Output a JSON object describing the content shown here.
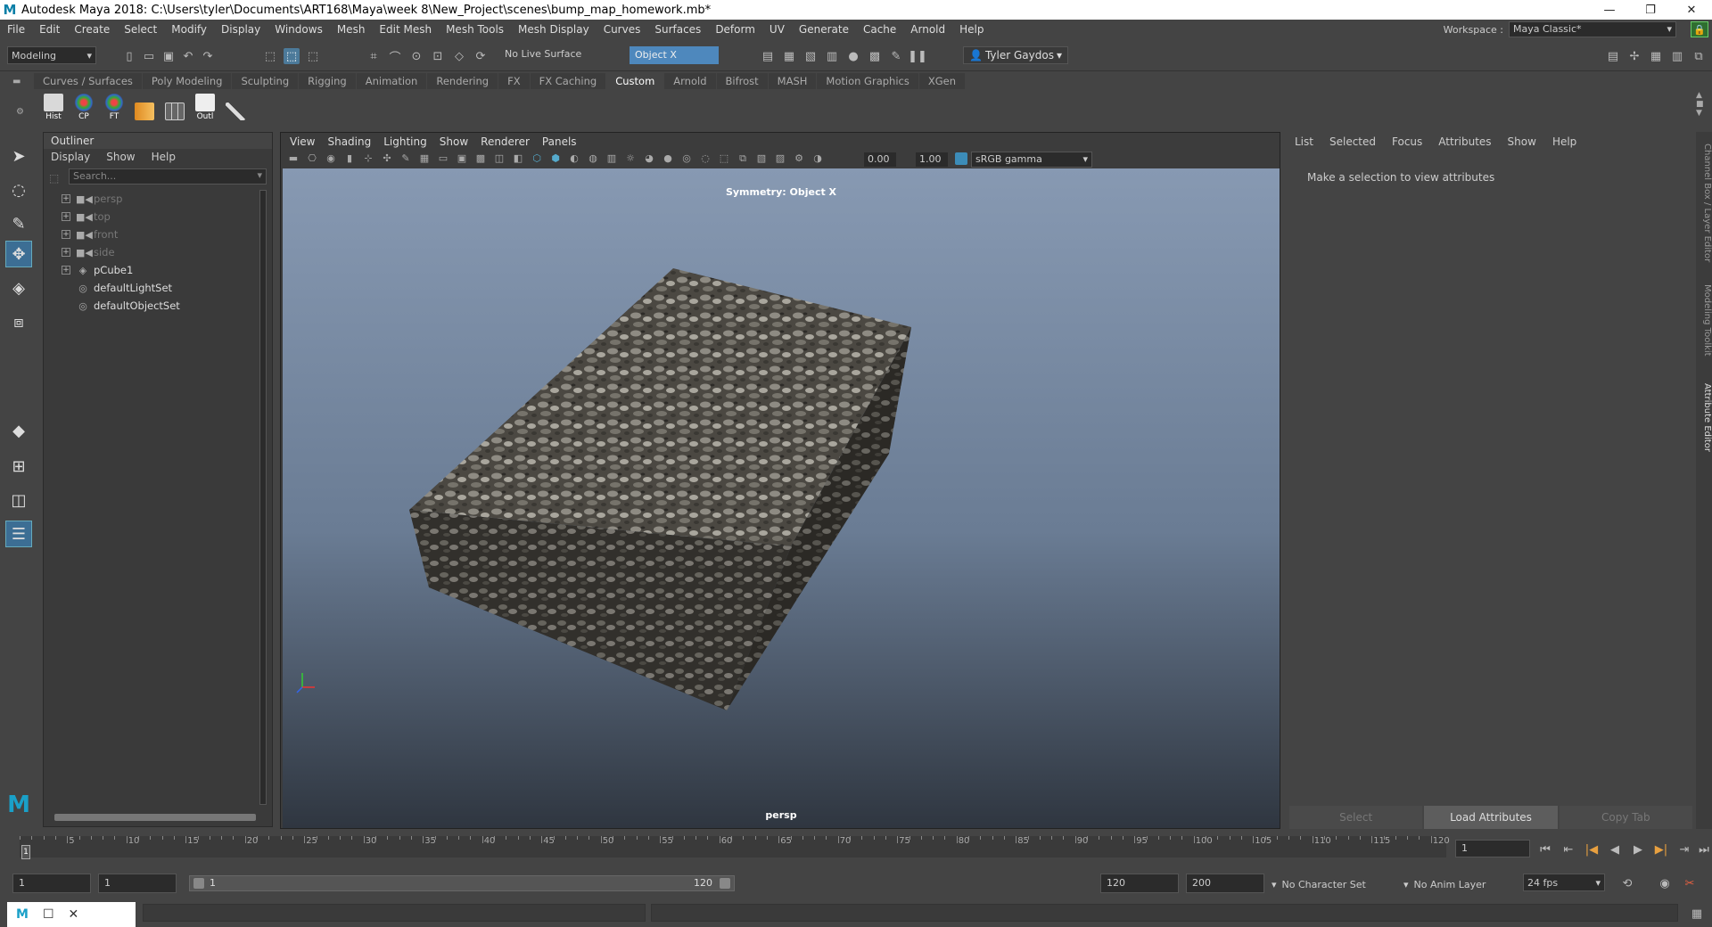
{
  "title_bar": {
    "logo": "M",
    "title": "Autodesk Maya 2018: C:\\Users\\tyler\\Documents\\ART168\\Maya\\week 8\\New_Project\\scenes\\bump_map_homework.mb*",
    "minimize": "—",
    "restore": "❐",
    "close": "✕"
  },
  "menu_bar": {
    "items": [
      "File",
      "Edit",
      "Create",
      "Select",
      "Modify",
      "Display",
      "Windows",
      "Mesh",
      "Edit Mesh",
      "Mesh Tools",
      "Mesh Display",
      "Curves",
      "Surfaces",
      "Deform",
      "UV",
      "Generate",
      "Cache",
      "Arnold",
      "Help"
    ],
    "workspace_label": "Workspace :",
    "workspace_value": "Maya Classic*"
  },
  "status_line": {
    "menu_set": "Modeling",
    "live_surface": "No Live Surface",
    "symmetry": "Object X",
    "user": "Tyler Gaydos"
  },
  "shelf": {
    "tabs": [
      "Curves / Surfaces",
      "Poly Modeling",
      "Sculpting",
      "Rigging",
      "Animation",
      "Rendering",
      "FX",
      "FX Caching",
      "Custom",
      "Arnold",
      "Bifrost",
      "MASH",
      "Motion Graphics",
      "XGen"
    ],
    "active_tab": "Custom",
    "buttons": [
      "Hist",
      "CP",
      "FT",
      "",
      "",
      "Outl",
      ""
    ]
  },
  "outliner": {
    "title": "Outliner",
    "menu": [
      "Display",
      "Show",
      "Help"
    ],
    "search_placeholder": "Search...",
    "nodes": [
      {
        "label": "persp",
        "icon": "camera-icon",
        "dim": true,
        "expandable": true
      },
      {
        "label": "top",
        "icon": "camera-icon",
        "dim": true,
        "expandable": true
      },
      {
        "label": "front",
        "icon": "camera-icon",
        "dim": true,
        "expandable": true
      },
      {
        "label": "side",
        "icon": "camera-icon",
        "dim": true,
        "expandable": true
      },
      {
        "label": "pCube1",
        "icon": "transform-icon",
        "dim": false,
        "expandable": true
      },
      {
        "label": "defaultLightSet",
        "icon": "set-icon",
        "dim": false,
        "expandable": false
      },
      {
        "label": "defaultObjectSet",
        "icon": "set-icon",
        "dim": false,
        "expandable": false
      }
    ]
  },
  "viewport": {
    "menu": [
      "View",
      "Shading",
      "Lighting",
      "Show",
      "Renderer",
      "Panels"
    ],
    "exposure": "0.00",
    "gamma": "1.00",
    "color_space": "sRGB gamma",
    "symmetry_label": "Symmetry: Object X",
    "camera_label": "persp"
  },
  "attribute_editor": {
    "menu": [
      "List",
      "Selected",
      "Focus",
      "Attributes",
      "Show",
      "Help"
    ],
    "message": "Make a selection to view attributes",
    "buttons": [
      "Select",
      "Load Attributes",
      "Copy Tab"
    ],
    "side_tabs": [
      "Channel Box / Layer Editor",
      "Modeling Toolkit",
      "Attribute Editor"
    ]
  },
  "time_slider": {
    "ticks": [
      "5",
      "10",
      "15",
      "20",
      "25",
      "30",
      "35",
      "40",
      "45",
      "50",
      "55",
      "60",
      "65",
      "70",
      "75",
      "80",
      "85",
      "90",
      "95",
      "100",
      "105",
      "110",
      "115",
      "120"
    ],
    "start_label": "1",
    "current_frame": "1",
    "current_field": "1"
  },
  "range_slider": {
    "start": "1",
    "playback_start": "1",
    "range_start": "1",
    "range_end": "120",
    "playback_end": "120",
    "end": "200",
    "character_set": "No Character Set",
    "anim_layer": "No Anim Layer",
    "fps": "24 fps"
  },
  "taskbar_thumb": {
    "logo": "M"
  }
}
